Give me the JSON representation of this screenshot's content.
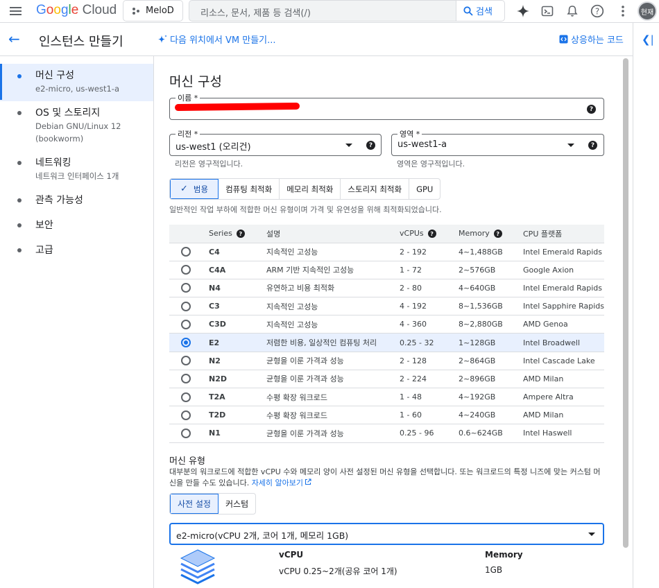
{
  "topbar": {
    "logo_google": "Google",
    "logo_cloud": " Cloud",
    "project": "MeloD",
    "search_placeholder": "리소스, 문서, 제품 등 검색(/)",
    "search_button": "검색",
    "avatar": "현재"
  },
  "header": {
    "title": "인스턴스 만들기",
    "vm_link": "다음 위치에서 VM 만들기...",
    "code_link": "상응하는 코드"
  },
  "nav": {
    "items": [
      {
        "title": "머신 구성",
        "sub": "e2-micro, us-west1-a"
      },
      {
        "title": "OS 및 스토리지",
        "sub": "Debian GNU/Linux 12",
        "sub2": "(bookworm)"
      },
      {
        "title": "네트워킹",
        "sub": "네트워크 인터페이스 1개"
      },
      {
        "title": "관측 가능성"
      },
      {
        "title": "보안"
      },
      {
        "title": "고급"
      }
    ]
  },
  "machine_config": {
    "title": "머신 구성",
    "name_label": "이름 *",
    "region_label": "리전 *",
    "region_value": "us-west1 (오리건)",
    "region_hint": "리전은 영구적입니다.",
    "zone_label": "영역 *",
    "zone_value": "us-west1-a",
    "zone_hint": "영역은 영구적입니다.",
    "families": [
      "범용",
      "컴퓨팅 최적화",
      "메모리 최적화",
      "스토리지 최적화",
      "GPU"
    ],
    "family_desc": "일반적인 작업 부하에 적합한 머신 유형이며 가격 및 유연성을 위해 최적화되었습니다.",
    "columns": {
      "series": "Series",
      "desc": "설명",
      "vcpus": "vCPUs",
      "memory": "Memory",
      "platform": "CPU 플랫폼"
    },
    "rows": [
      {
        "series": "C4",
        "desc": "지속적인 고성능",
        "vcpus": "2 - 192",
        "memory": "4~1,488GB",
        "platform": "Intel Emerald Rapids"
      },
      {
        "series": "C4A",
        "desc": "ARM 기반 지속적인 고성능",
        "vcpus": "1 - 72",
        "memory": "2~576GB",
        "platform": "Google Axion"
      },
      {
        "series": "N4",
        "desc": "유연하고 비용 최적화",
        "vcpus": "2 - 80",
        "memory": "4~640GB",
        "platform": "Intel Emerald Rapids"
      },
      {
        "series": "C3",
        "desc": "지속적인 고성능",
        "vcpus": "4 - 192",
        "memory": "8~1,536GB",
        "platform": "Intel Sapphire Rapids"
      },
      {
        "series": "C3D",
        "desc": "지속적인 고성능",
        "vcpus": "4 - 360",
        "memory": "8~2,880GB",
        "platform": "AMD Genoa"
      },
      {
        "series": "E2",
        "desc": "저렴한 비용, 일상적인 컴퓨팅 처리",
        "vcpus": "0.25 - 32",
        "memory": "1~128GB",
        "platform": "Intel Broadwell"
      },
      {
        "series": "N2",
        "desc": "균형을 이룬 가격과 성능",
        "vcpus": "2 - 128",
        "memory": "2~864GB",
        "platform": "Intel Cascade Lake"
      },
      {
        "series": "N2D",
        "desc": "균형을 이룬 가격과 성능",
        "vcpus": "2 - 224",
        "memory": "2~896GB",
        "platform": "AMD Milan"
      },
      {
        "series": "T2A",
        "desc": "수평 확장 워크로드",
        "vcpus": "1 - 48",
        "memory": "4~192GB",
        "platform": "Ampere Altra"
      },
      {
        "series": "T2D",
        "desc": "수평 확장 워크로드",
        "vcpus": "1 - 60",
        "memory": "4~240GB",
        "platform": "AMD Milan"
      },
      {
        "series": "N1",
        "desc": "균형을 이룬 가격과 성능",
        "vcpus": "0.25 - 96",
        "memory": "0.6~624GB",
        "platform": "Intel Haswell"
      }
    ],
    "machine_type": {
      "title": "머신 유형",
      "desc": "대부분의 워크로드에 적합한 vCPU 수와 메모리 양이 사전 설정된 머신 유형을 선택합니다. 또는 워크로드의 특정 니즈에 맞는 커스텀 머신을 만들 수도 있습니다.",
      "learn_more": "자세히 알아보기",
      "tabs": [
        "사전 설정",
        "커스텀"
      ],
      "selected": "e2-micro(vCPU 2개, 코어 1개, 메모리 1GB)",
      "vcpu_header": "vCPU",
      "vcpu_value": "vCPU 0.25~2개(공유 코어 1개)",
      "memory_header": "Memory",
      "memory_value": "1GB"
    }
  }
}
